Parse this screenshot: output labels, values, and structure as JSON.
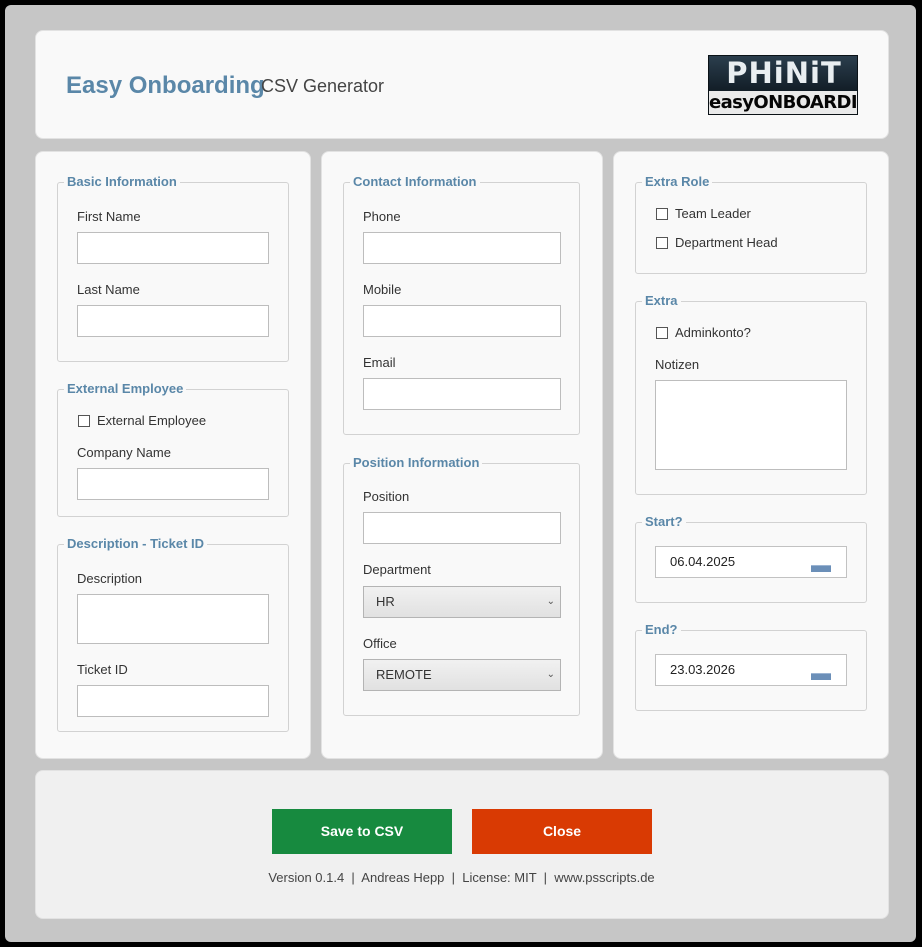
{
  "header": {
    "title": "Easy Onboarding",
    "subtitle": "CSV Generator",
    "logo_top": "PHiNiT",
    "logo_bottom": "easyONBOARDING"
  },
  "basic_info": {
    "legend": "Basic Information",
    "first_name_label": "First Name",
    "first_name_value": "",
    "last_name_label": "Last Name",
    "last_name_value": ""
  },
  "external_employee": {
    "legend": "External Employee",
    "checkbox_label": "External Employee",
    "checked": false,
    "company_name_label": "Company Name",
    "company_name_value": ""
  },
  "description_ticket": {
    "legend": "Description - Ticket ID",
    "description_label": "Description",
    "description_value": "",
    "ticket_id_label": "Ticket ID",
    "ticket_id_value": ""
  },
  "contact_info": {
    "legend": "Contact Information",
    "phone_label": "Phone",
    "phone_value": "",
    "mobile_label": "Mobile",
    "mobile_value": "",
    "email_label": "Email",
    "email_value": ""
  },
  "position_info": {
    "legend": "Position Information",
    "position_label": "Position",
    "position_value": "",
    "department_label": "Department",
    "department_value": "HR",
    "office_label": "Office",
    "office_value": "REMOTE"
  },
  "extra_role": {
    "legend": "Extra Role",
    "team_leader_label": "Team Leader",
    "team_leader_checked": false,
    "department_head_label": "Department Head",
    "department_head_checked": false
  },
  "extra": {
    "legend": "Extra",
    "adminkonto_label": "Adminkonto?",
    "adminkonto_checked": false,
    "notizen_label": "Notizen",
    "notizen_value": ""
  },
  "start": {
    "legend": "Start?",
    "date": "06.04.2025"
  },
  "end": {
    "legend": "End?",
    "date": "23.03.2026"
  },
  "buttons": {
    "save_label": "Save to CSV",
    "save_color": "#178a3f",
    "close_label": "Close",
    "close_color": "#d93a03"
  },
  "footer": {
    "text": "Version 0.1.4  |  Andreas Hepp  |  License: MIT  |  www.psscripts.de"
  },
  "icons": {
    "date_picker": "calendar-icon",
    "select": "chevron-down-icon"
  }
}
